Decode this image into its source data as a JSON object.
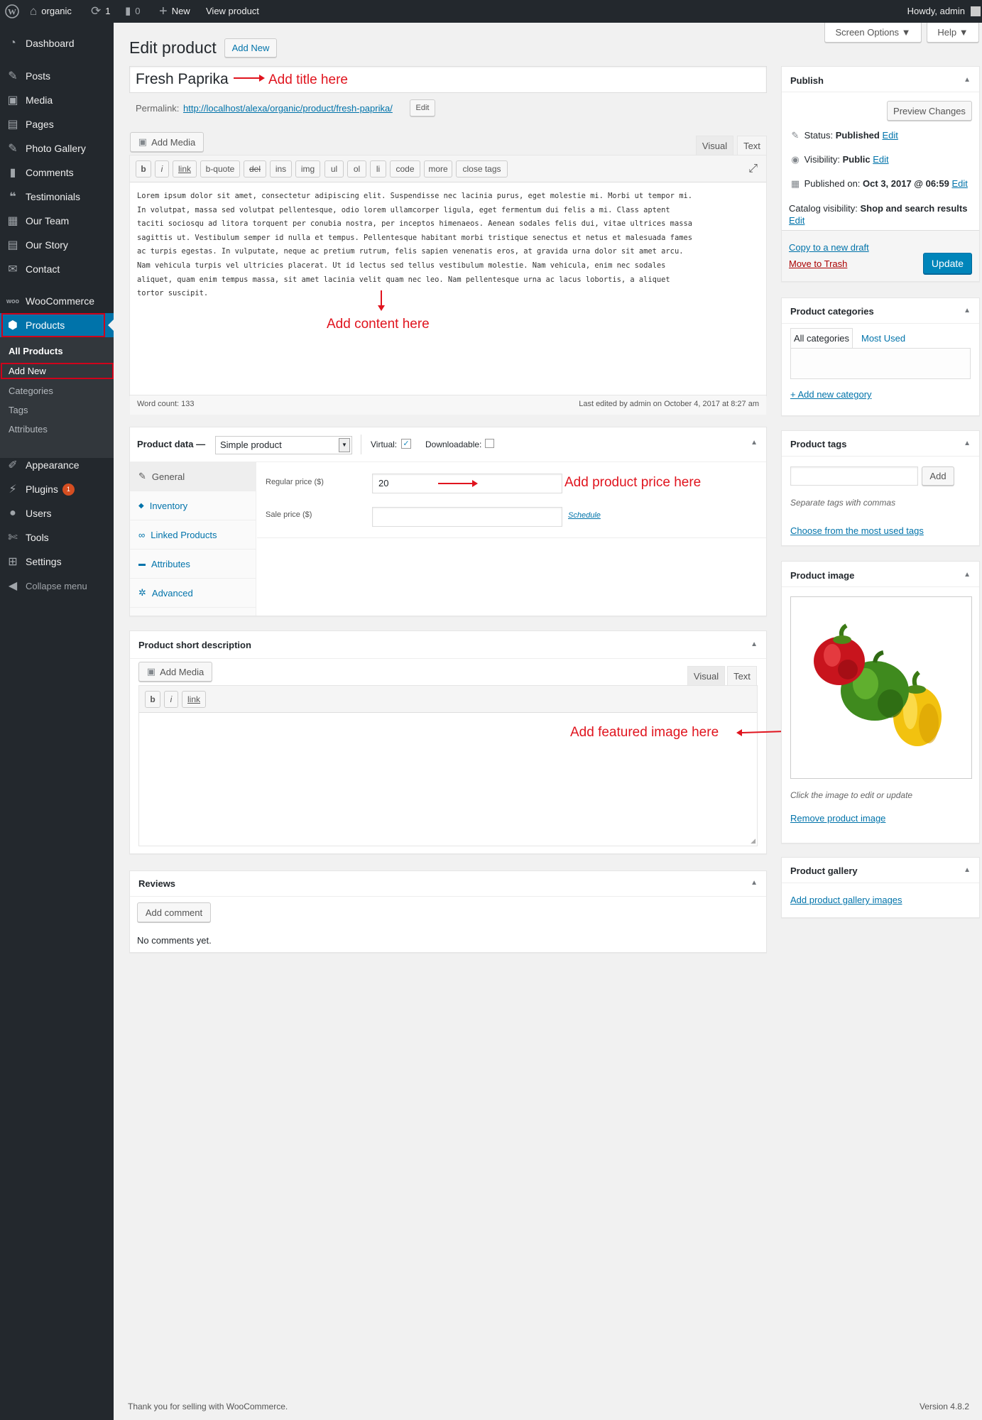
{
  "admin_bar": {
    "site_name": "organic",
    "updates_count": "1",
    "comments_count": "0",
    "new_label": "New",
    "view_label": "View product",
    "howdy": "Howdy, admin"
  },
  "sidebar": {
    "items": [
      {
        "label": "Dashboard",
        "icon": "dashboard-icon"
      },
      {
        "label": "Posts",
        "icon": "pin-icon"
      },
      {
        "label": "Media",
        "icon": "media-icon"
      },
      {
        "label": "Pages",
        "icon": "pages-icon"
      },
      {
        "label": "Photo Gallery",
        "icon": "pin-icon"
      },
      {
        "label": "Comments",
        "icon": "comment-icon"
      },
      {
        "label": "Testimonials",
        "icon": "quote-icon"
      },
      {
        "label": "Our Team",
        "icon": "team-icon"
      },
      {
        "label": "Our Story",
        "icon": "story-icon"
      },
      {
        "label": "Contact",
        "icon": "mail-icon"
      },
      {
        "label": "WooCommerce",
        "icon": "woo-icon"
      },
      {
        "label": "Products",
        "icon": "cube-icon"
      },
      {
        "label": "Appearance",
        "icon": "brush-icon"
      },
      {
        "label": "Plugins",
        "icon": "plug-icon",
        "badge": "1"
      },
      {
        "label": "Users",
        "icon": "user-icon"
      },
      {
        "label": "Tools",
        "icon": "wrench-icon"
      },
      {
        "label": "Settings",
        "icon": "settings-icon"
      },
      {
        "label": "Collapse menu",
        "icon": "collapse-icon"
      }
    ],
    "submenu": [
      "All Products",
      "Add New",
      "Categories",
      "Tags",
      "Attributes"
    ]
  },
  "header": {
    "screen_options": "Screen Options ▼",
    "help": "Help ▼",
    "page_title": "Edit product",
    "add_new": "Add New"
  },
  "title_box": {
    "value": "Fresh Paprika",
    "permalink_label": "Permalink:",
    "permalink_url": "http://localhost/alexa/organic/product/fresh-paprika/",
    "edit_button": "Edit"
  },
  "editor": {
    "add_media": "Add Media",
    "tab_visual": "Visual",
    "tab_text": "Text",
    "quicktags": [
      "b",
      "i",
      "link",
      "b-quote",
      "del",
      "ins",
      "img",
      "ul",
      "ol",
      "li",
      "code",
      "more",
      "close tags"
    ],
    "content_lines": [
      "Lorem ipsum dolor sit amet, consectetur adipiscing elit. Suspendisse nec lacinia purus, eget molestie mi. Morbi ut tempor mi.",
      "In volutpat, massa sed volutpat pellentesque, odio lorem ullamcorper ligula, eget fermentum dui felis a mi. Class aptent",
      "taciti sociosqu ad litora torquent per conubia nostra, per inceptos himenaeos. Aenean sodales felis dui, vitae ultrices massa",
      "sagittis ut. Vestibulum semper id nulla et tempus. Pellentesque habitant morbi tristique senectus et netus et malesuada fames",
      "ac turpis egestas. In vulputate, neque ac pretium rutrum, felis sapien venenatis eros, at gravida urna dolor sit amet arcu.",
      "Nam vehicula turpis vel ultricies placerat. Ut id lectus sed tellus vestibulum molestie. Nam vehicula, enim nec sodales",
      "aliquet, quam enim tempus massa, sit amet lacinia velit quam nec leo. Nam pellentesque urna ac lacus lobortis, a aliquet",
      "tortor suscipit."
    ],
    "word_count": "Word count: 133",
    "last_edited": "Last edited by admin on October 4, 2017 at 8:27 am"
  },
  "product_data": {
    "label": "Product data —",
    "type_value": "Simple product",
    "virtual_label": "Virtual:",
    "downloadable_label": "Downloadable:",
    "tabs": [
      "General",
      "Inventory",
      "Linked Products",
      "Attributes",
      "Advanced"
    ],
    "regular_price_label": "Regular price ($)",
    "regular_price_value": "20",
    "sale_price_label": "Sale price ($)",
    "sale_price_value": "",
    "schedule": "Schedule"
  },
  "short_desc": {
    "title": "Product short description",
    "add_media": "Add Media",
    "tab_visual": "Visual",
    "tab_text": "Text",
    "quicktags": [
      "b",
      "i",
      "link"
    ]
  },
  "reviews": {
    "title": "Reviews",
    "add_comment": "Add comment",
    "empty": "No comments yet."
  },
  "publish": {
    "title": "Publish",
    "preview": "Preview Changes",
    "status_label": "Status:",
    "status_value": "Published",
    "visibility_label": "Visibility:",
    "visibility_value": "Public",
    "published_label": "Published on:",
    "published_value": "Oct 3, 2017 @ 06:59",
    "catalog_label": "Catalog visibility:",
    "catalog_value": "Shop and search results",
    "edit": "Edit",
    "copy_draft": "Copy to a new draft",
    "trash": "Move to Trash",
    "update": "Update"
  },
  "categories": {
    "title": "Product categories",
    "tab_all": "All categories",
    "tab_most": "Most Used",
    "add_new": "+ Add new category"
  },
  "tags": {
    "title": "Product tags",
    "add": "Add",
    "hint": "Separate tags with commas",
    "choose": "Choose from the most used tags"
  },
  "product_image": {
    "title": "Product image",
    "hint": "Click the image to edit or update",
    "remove": "Remove product image"
  },
  "gallery": {
    "title": "Product gallery",
    "add": "Add product gallery images"
  },
  "annotations": {
    "title": "Add title here",
    "content": "Add content here",
    "price": "Add product price here",
    "image": "Add featured image here"
  },
  "footer": {
    "thanks": "Thank you for selling with WooCommerce.",
    "version": "Version 4.8.2"
  },
  "colors": {
    "admin_dark": "#23282d",
    "accent_blue": "#0073aa",
    "annotation_red": "#e0141e",
    "trash_red": "#a00"
  }
}
